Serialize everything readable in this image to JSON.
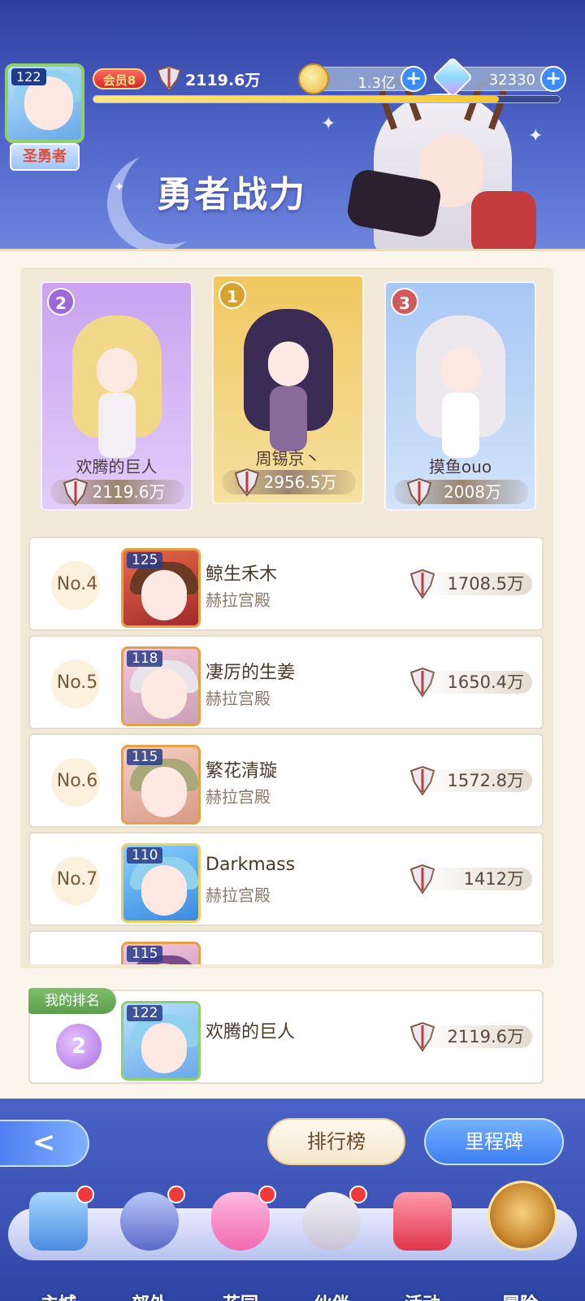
{
  "header": {
    "player_level": "122",
    "player_title": "圣勇者",
    "vip_label": "会员8",
    "power": "2119.6万",
    "gold": "1.3亿",
    "gems": "32330",
    "page_title": "勇者战力",
    "xp_progress": 0.87
  },
  "top3": [
    {
      "rank": "2",
      "name": "欢腾的巨人",
      "power": "2119.6万"
    },
    {
      "rank": "1",
      "name": "周锡京丶",
      "power": "2956.5万"
    },
    {
      "rank": "3",
      "name": "摸鱼ouo",
      "power": "2008万"
    }
  ],
  "rows": [
    {
      "rank": "No.4",
      "level": "125",
      "name": "鲸生禾木",
      "guild": "赫拉宫殿",
      "power": "1708.5万"
    },
    {
      "rank": "No.5",
      "level": "118",
      "name": "凄厉的生姜",
      "guild": "赫拉宫殿",
      "power": "1650.4万"
    },
    {
      "rank": "No.6",
      "level": "115",
      "name": "繁花清璇",
      "guild": "赫拉宫殿",
      "power": "1572.8万"
    },
    {
      "rank": "No.7",
      "level": "110",
      "name": "Darkmass",
      "guild": "赫拉宫殿",
      "power": "1412万"
    },
    {
      "rank": "",
      "level": "115",
      "name": "",
      "guild": "",
      "power": ""
    }
  ],
  "mine": {
    "label": "我的排名",
    "rank": "2",
    "level": "122",
    "name": "欢腾的巨人",
    "power": "2119.6万"
  },
  "buttons": {
    "back": "<",
    "leaderboard": "排行榜",
    "milestone": "里程碑"
  },
  "nav": [
    {
      "label": "主城",
      "dot": true
    },
    {
      "label": "郊外",
      "dot": true
    },
    {
      "label": "花园",
      "dot": true
    },
    {
      "label": "伙伴",
      "dot": true
    },
    {
      "label": "活动",
      "dot": false
    },
    {
      "label": "冒险",
      "dot": false
    }
  ],
  "colors": {
    "rank1": "#f0c860",
    "rank2": "#c9a3f0",
    "rank3": "#a8c8f4",
    "accent_blue": "#3c8cff"
  }
}
